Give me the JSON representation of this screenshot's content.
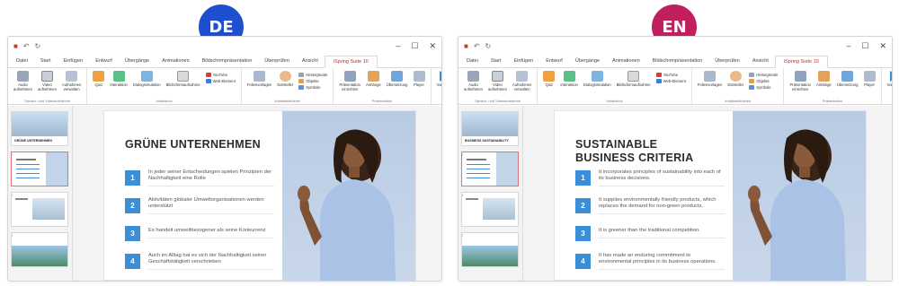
{
  "colors": {
    "de_badge": "#1f4fd1",
    "en_badge": "#c21f5e",
    "accent": "#c62828",
    "number_box": "#3b8fd8"
  },
  "windows": [
    {
      "badge": "DE",
      "tabs": [
        "Datei",
        "Start",
        "Einfügen",
        "Entwurf",
        "Übergänge",
        "Animationen",
        "Bildschirmpräsentation",
        "Überprüfen",
        "Ansicht",
        "iSpring Suite 10"
      ],
      "ribbon": {
        "g1": {
          "b1": "Audio aufnehmen",
          "b2": "Video aufnehmen",
          "b3": "Aufnahmen verwalten",
          "label": "Sprach- und Videoaufnahme"
        },
        "g2": {
          "b1": "Quiz",
          "b2": "Interaktion",
          "b3": "Dialogsimulation",
          "b4": "Bildschirmaufnahme",
          "m1": "YouTube",
          "m2": "Web-Element",
          "label": "Inhaltsbox"
        },
        "g3": {
          "b1": "Folienvorlagen",
          "b2": "Darsteller",
          "m1": "Hintergründe",
          "m2": "Objekte",
          "m3": "Symbole",
          "label": "Inhaltsbibliothek"
        },
        "g4": {
          "b1": "Präsentation einrichten",
          "b2": "Anhänge",
          "b3": "Übersetzung",
          "b4": "Player",
          "label": "Präsentation"
        },
        "g5": {
          "b1": "Vorschau",
          "b2": "Veröffentlichen",
          "label": "Veröffentlichen"
        }
      },
      "thumbs": {
        "n1": "1",
        "n2": "2",
        "n3": "3",
        "n4": "4",
        "t1": "GRÜNE UNTERNEHMEN"
      },
      "slide": {
        "title": "GRÜNE UNTERNEHMEN",
        "items": [
          {
            "num": "1",
            "text": "In jeder seiner Entscheidungen spielen Prinzipien der Nachhaltigkeit eine Rolle"
          },
          {
            "num": "2",
            "text": "Aktivitäten globaler Umweltorganisationen werden unterstützt"
          },
          {
            "num": "3",
            "text": "Es handelt umweltbezogener als seine Konkurrenz"
          },
          {
            "num": "4",
            "text": "Auch im Alltag hat es sich der Nachhaltigkeit seiner Geschäftstätigkeit verschrieben"
          }
        ]
      }
    },
    {
      "badge": "EN",
      "tabs": [
        "Datei",
        "Start",
        "Einfügen",
        "Entwurf",
        "Übergänge",
        "Animationen",
        "Bildschirmpräsentation",
        "Überprüfen",
        "Ansicht",
        "iSpring Suite 10"
      ],
      "ribbon": {
        "g1": {
          "b1": "Audio aufnehmen",
          "b2": "Video aufnehmen",
          "b3": "Aufnahmen verwalten",
          "label": "Sprach- und Videoaufnahme"
        },
        "g2": {
          "b1": "Quiz",
          "b2": "Interaktion",
          "b3": "Dialogsimulation",
          "b4": "Bildschirmaufnahme",
          "m1": "YouTube",
          "m2": "Web-Element",
          "label": "Inhaltsbox"
        },
        "g3": {
          "b1": "Folienvorlagen",
          "b2": "Darsteller",
          "m1": "Hintergründe",
          "m2": "Objekte",
          "m3": "Symbole",
          "label": "Inhaltsbibliothek"
        },
        "g4": {
          "b1": "Präsentation einrichten",
          "b2": "Anhänge",
          "b3": "Übersetzung",
          "b4": "Player",
          "label": "Präsentation"
        },
        "g5": {
          "b1": "Vorschau",
          "b2": "Veröffentlichen",
          "label": "Veröffentlichen"
        }
      },
      "thumbs": {
        "n1": "1",
        "n2": "2",
        "n3": "3",
        "n4": "4",
        "t1": "BUSINESS SUSTAINABILITY"
      },
      "slide": {
        "title": "SUSTAINABLE\nBUSINESS CRITERIA",
        "items": [
          {
            "num": "1",
            "text": "It incorporates principles of sustainability into each of its business decisions."
          },
          {
            "num": "2",
            "text": "It supplies environmentally friendly products, which replaces the demand for non-green products."
          },
          {
            "num": "3",
            "text": "It is greener than the traditional competition."
          },
          {
            "num": "4",
            "text": "It has made an enduring commitment to environmental principles in its business operations."
          }
        ]
      }
    }
  ]
}
